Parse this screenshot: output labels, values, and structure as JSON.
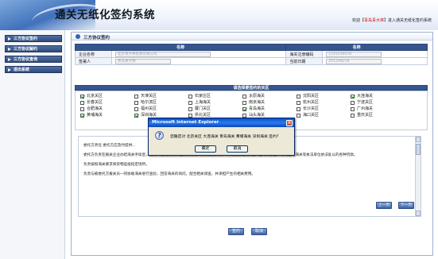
{
  "header": {
    "title": "通关无纸化签约系统",
    "welcome_prefix": "欢迎【",
    "user": "青岛青大林",
    "welcome_suffix": "】进入通关无纸化签约系统"
  },
  "sidebar": {
    "items": [
      {
        "label": "三方协议签约"
      },
      {
        "label": "三方协议解约"
      },
      {
        "label": "三方协议查询"
      },
      {
        "label": "退出系统"
      }
    ]
  },
  "page": {
    "title": "三方协议签约"
  },
  "info_table": {
    "headers": [
      "名称",
      "名称"
    ],
    "rows": [
      {
        "label1": "企业名称",
        "value1": "北京青大林贸易有限公司",
        "label2": "海关注册编码",
        "value2": "1101030078"
      },
      {
        "label1": "签署人",
        "value1": "青岛青大林",
        "label2": "当前日期",
        "value2": "2012/06/18"
      }
    ]
  },
  "customs": {
    "header": "请选择要签约的关区",
    "items": [
      {
        "label": "北京关区",
        "checked": true
      },
      {
        "label": "天津关区",
        "checked": false
      },
      {
        "label": "石家庄区",
        "checked": false
      },
      {
        "label": "太原海关",
        "checked": false
      },
      {
        "label": "沈阳关区",
        "checked": false
      },
      {
        "label": "大连海关",
        "checked": true
      },
      {
        "label": "长春关区",
        "checked": false
      },
      {
        "label": "哈尔滨区",
        "checked": false
      },
      {
        "label": "上海海关",
        "checked": false
      },
      {
        "label": "南京海关",
        "checked": false
      },
      {
        "label": "杭州关区",
        "checked": false
      },
      {
        "label": "宁波关区",
        "checked": false
      },
      {
        "label": "合肥海关",
        "checked": false
      },
      {
        "label": "福州关区",
        "checked": false
      },
      {
        "label": "厦门关区",
        "checked": false
      },
      {
        "label": "青岛海关",
        "checked": true
      },
      {
        "label": "长沙关区",
        "checked": false
      },
      {
        "label": "广州海关",
        "checked": false
      },
      {
        "label": "黄埔海关",
        "checked": true
      },
      {
        "label": "深圳海关",
        "checked": true
      },
      {
        "label": "拱北关区",
        "checked": false
      },
      {
        "label": "汕头海关",
        "checked": false
      },
      {
        "label": "海口关区",
        "checked": false
      },
      {
        "label": "重庆关区",
        "checked": false
      }
    ]
  },
  "notice": {
    "lines": [
      "委托方责任  委托方应及时提供…",
      "委托方负责在报关企业办结海关手续后，及时、履约支付代理报关费用，支付垫支费用，以及因委托方责任产生的滞报金、滞纳金和海关等执法单位依法处以的各种罚款。",
      "负责按照海关要求将货物运抵指定场所。",
      "负责与被委托方报关员一同协助海关进行查验，回答海关的询问，配合相关调查，并承担产生的相关费用。"
    ]
  },
  "notice_buttons": {
    "prev": "上一页",
    "next": "下一页"
  },
  "actions": {
    "sign": "签约",
    "cancel": "取消"
  },
  "dialog": {
    "title": "Microsoft Internet Explorer",
    "message": "您确定对 北京关区 大连海关 青岛海关 黄埔海关 深圳海关 签约?",
    "ok": "确定",
    "cancel": "取消"
  },
  "colors": {
    "nav_blue": "#35558f",
    "dialog_title": "#0a52c6",
    "user_red": "#cc0000"
  }
}
